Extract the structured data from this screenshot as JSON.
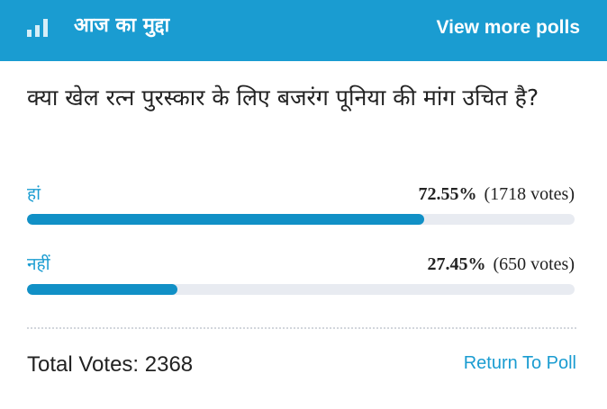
{
  "header": {
    "icon": "poll-bars-icon",
    "title": "आज का मुद्दा",
    "view_more_label": "View more polls"
  },
  "poll": {
    "question": "क्या खेल रत्न पुरस्कार के लिए बजरंग पूनिया की मांग उचित है?",
    "options": [
      {
        "label": "हां",
        "percent_text": "72.55%",
        "votes_text": "(1718 votes)",
        "fraction": 0.7255
      },
      {
        "label": "नहीं",
        "percent_text": "27.45%",
        "votes_text": "(650 votes)",
        "fraction": 0.2745
      }
    ],
    "total_votes_text": "Total Votes: 2368",
    "return_label": "Return To Poll"
  },
  "colors": {
    "accent": "#1a9cd1",
    "bar_fill": "#1190c6",
    "bar_track": "#e8ebf1"
  }
}
